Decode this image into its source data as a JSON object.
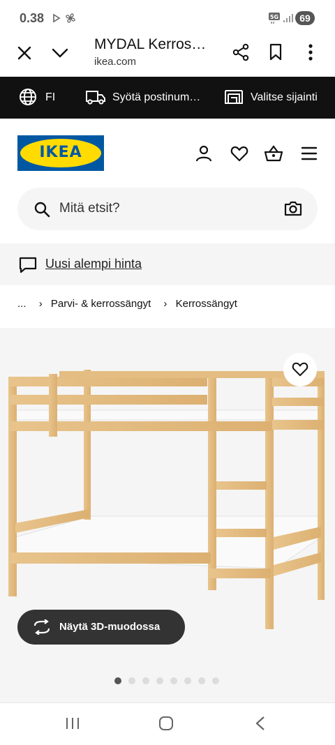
{
  "status_bar": {
    "time": "0.38",
    "network": "5G",
    "battery": "69"
  },
  "tab": {
    "title": "MYDAL Kerros…",
    "url": "ikea.com"
  },
  "topbar": {
    "language": "FI",
    "postcode": "Syötä postinum…",
    "store": "Valitse sijainti"
  },
  "header": {
    "logo_text": "IKEA"
  },
  "search": {
    "placeholder": "Mitä etsit?"
  },
  "promo": {
    "text": "Uusi alempi hinta"
  },
  "breadcrumb": {
    "items": [
      "...",
      "Parvi- & kerrossängyt",
      "Kerrossängyt"
    ]
  },
  "product": {
    "view_3d_label": "Näytä 3D-muodossa"
  },
  "carousel": {
    "count": 8,
    "active_index": 0
  },
  "colors": {
    "ikea_blue": "#0058a3",
    "ikea_yellow": "#ffdb00"
  }
}
